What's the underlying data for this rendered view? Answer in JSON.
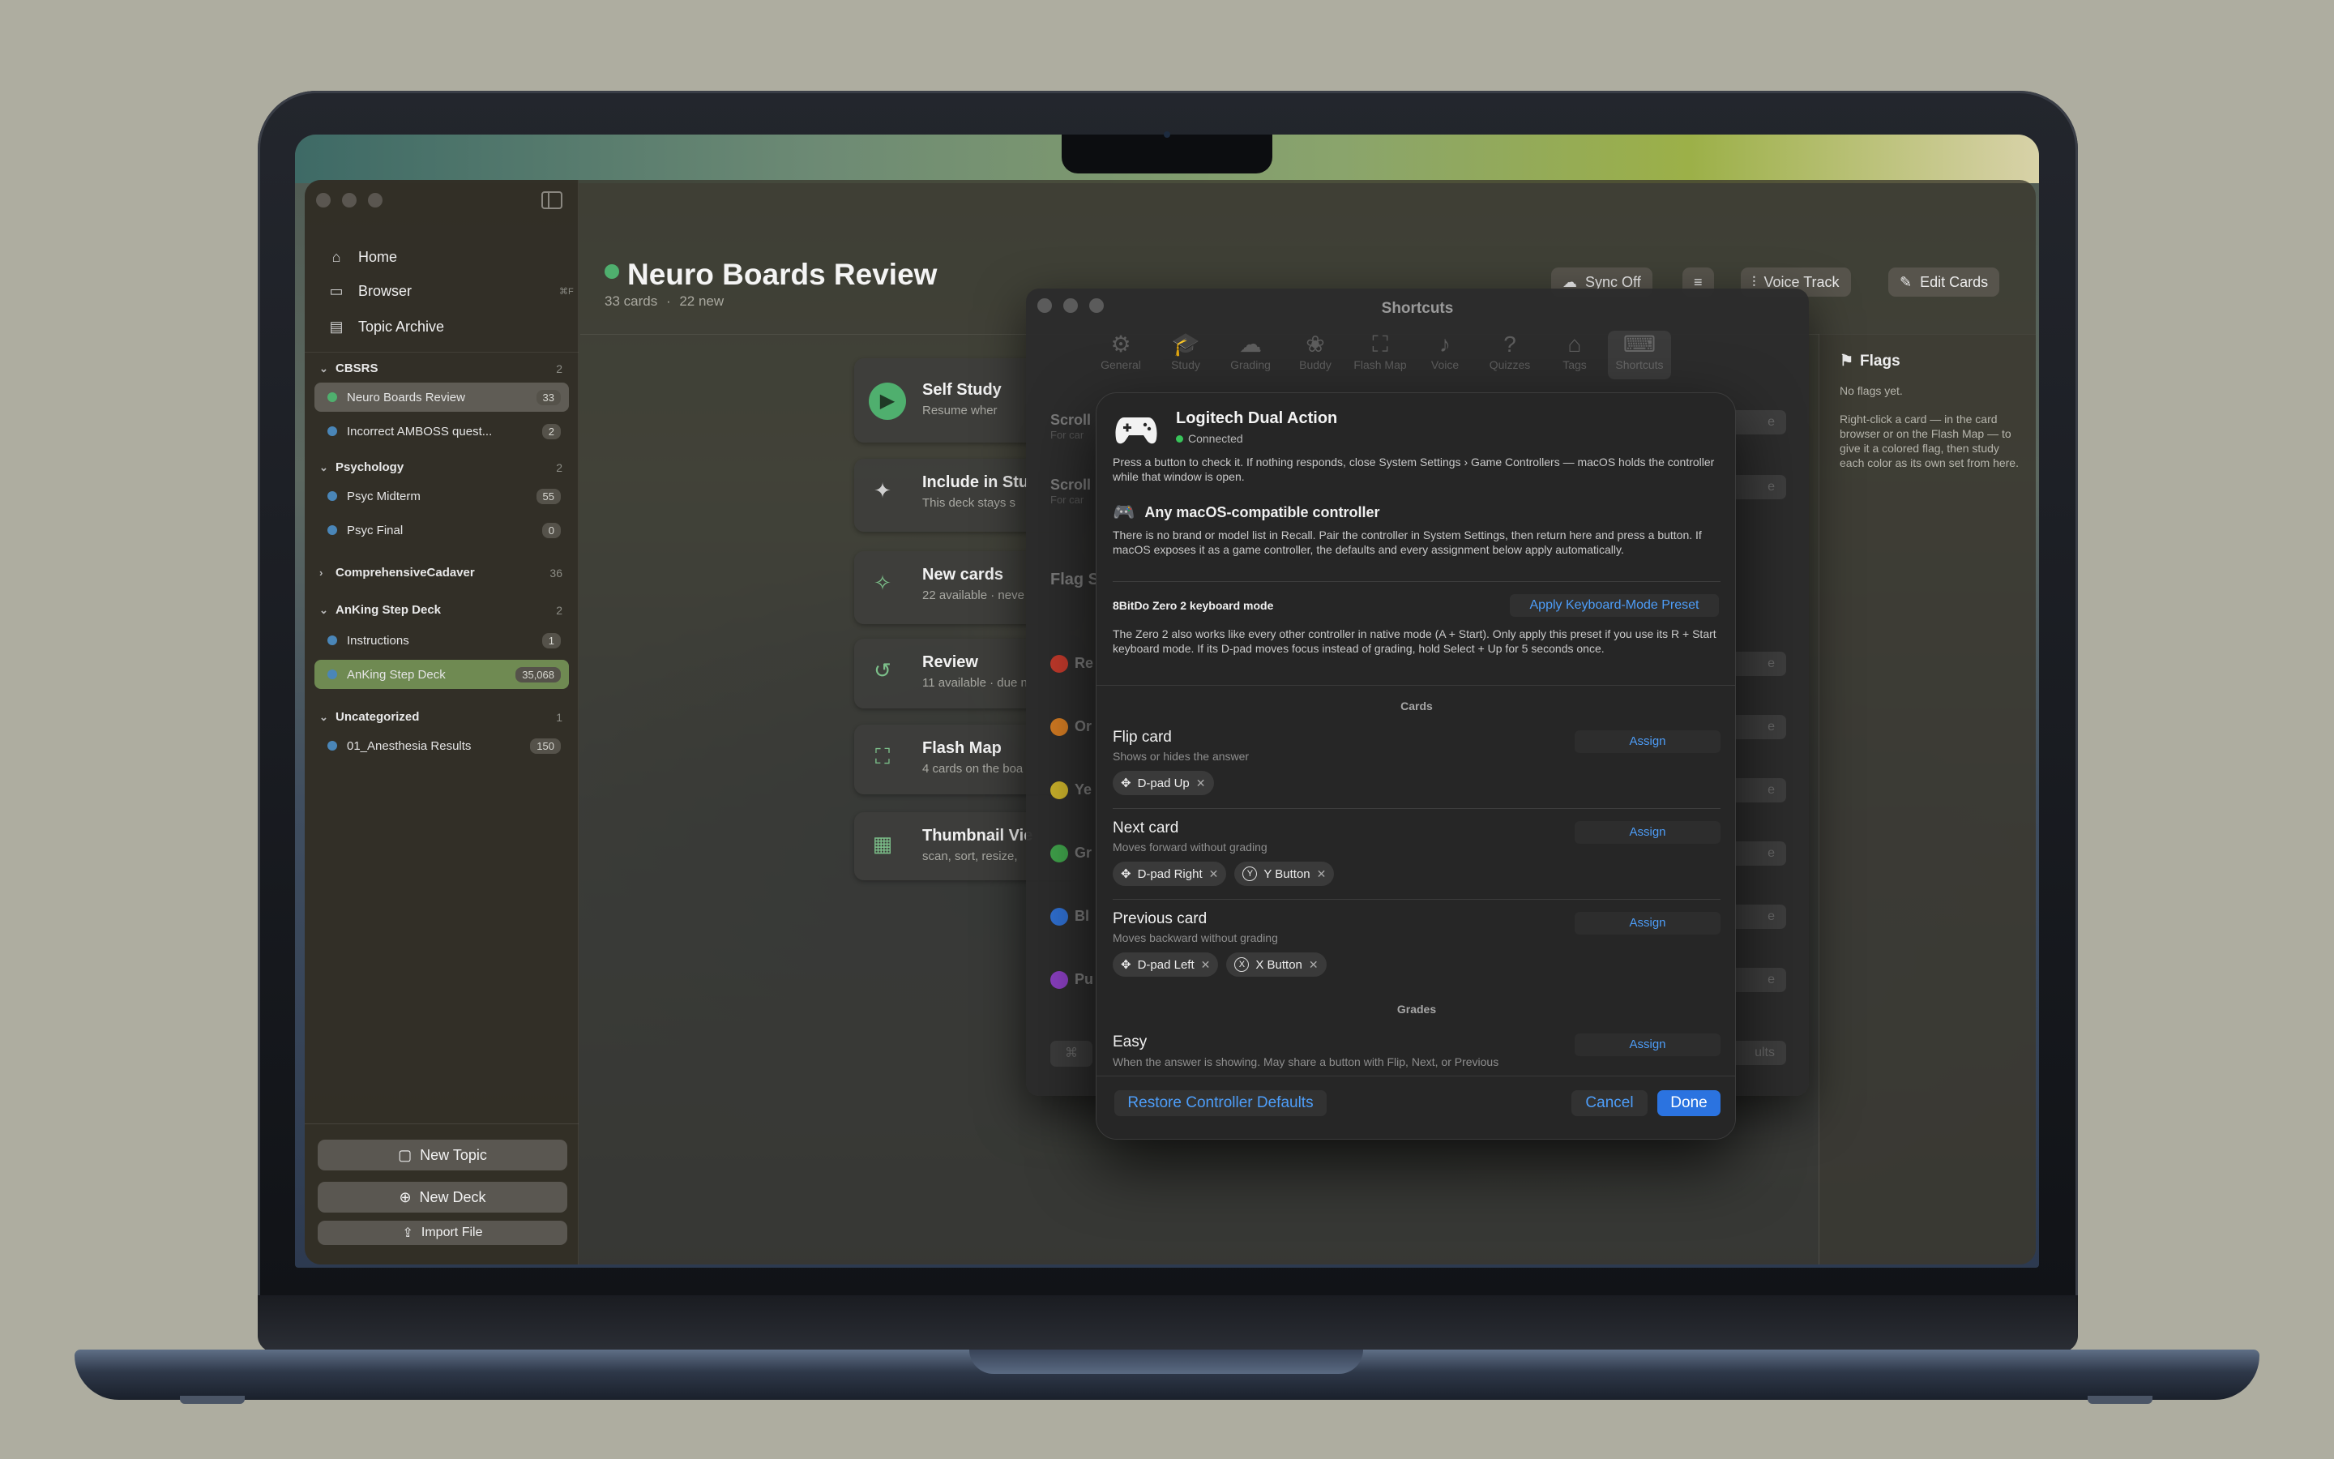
{
  "sidebar": {
    "nav": [
      {
        "label": "Home"
      },
      {
        "label": "Browser",
        "shortcut": "⌘F"
      },
      {
        "label": "Topic Archive"
      }
    ],
    "sections": [
      {
        "name": "CBSRS",
        "count": "2",
        "decks": [
          {
            "name": "Neuro Boards Review",
            "count": "33"
          },
          {
            "name": "Incorrect AMBOSS quest...",
            "count": "2"
          }
        ]
      },
      {
        "name": "Psychology",
        "count": "2",
        "decks": [
          {
            "name": "Psyc Midterm",
            "count": "55"
          },
          {
            "name": "Psyc Final",
            "count": "0"
          }
        ]
      },
      {
        "name": "ComprehensiveCadaver",
        "count": "36",
        "decks": []
      },
      {
        "name": "AnKing Step Deck",
        "count": "2",
        "decks": [
          {
            "name": "Instructions",
            "count": "1"
          },
          {
            "name": "AnKing Step Deck",
            "count": "35,068"
          }
        ]
      },
      {
        "name": "Uncategorized",
        "count": "1",
        "decks": [
          {
            "name": "01_Anesthesia Results",
            "count": "150"
          }
        ]
      }
    ],
    "buttons": {
      "new_topic": "New Topic",
      "new_deck": "New Deck",
      "import_file": "Import File"
    }
  },
  "main": {
    "title": "Neuro Boards Review",
    "cards_count": "33 cards",
    "separator": "·",
    "new_count": "22 new",
    "toolbar": {
      "sync": "Sync Off",
      "voice": "Voice Track",
      "edit": "Edit Cards"
    },
    "study_cards": [
      {
        "title": "Self Study",
        "subtitle": "Resume wher"
      },
      {
        "title": "Include in Stu",
        "subtitle": "This deck stays s"
      },
      {
        "title": "New cards",
        "subtitle": "22 available · neve"
      },
      {
        "title": "Review",
        "subtitle": "11 available · due n"
      },
      {
        "title": "Flash Map",
        "subtitle": "4 cards on the boa"
      },
      {
        "title": "Thumbnail Vie",
        "subtitle": "scan, sort, resize,"
      }
    ],
    "flags": {
      "title": "Flags",
      "empty": "No flags yet.",
      "help": "Right-click a card — in the card browser or on the Flash Map — to give it a colored flag, then study each color as its own set from here."
    }
  },
  "settings": {
    "title": "Shortcuts",
    "tabs": [
      "General",
      "Study",
      "Grading",
      "Buddy",
      "Flash Map",
      "Voice",
      "Quizzes",
      "Tags",
      "Shortcuts"
    ],
    "rows": [
      {
        "title": "Scroll",
        "sub": "For car"
      },
      {
        "title": "Scroll",
        "sub": "For car"
      }
    ],
    "flag_section": "Flag S",
    "flag_rows": [
      "Re",
      "Or",
      "Ye",
      "Gr",
      "Bl",
      "Pu"
    ],
    "restore_partial": "ults"
  },
  "controller": {
    "name": "Logitech Dual Action",
    "status": "Connected",
    "intro": "Press a button to check it. If nothing responds, close System Settings › Game Controllers — macOS holds the controller while that window is open.",
    "any_title": "Any macOS-compatible controller",
    "any_text": "There is no brand or model list in Recall. Pair the controller in System Settings, then return here and press a button. If macOS exposes it as a game controller, the defaults and every assignment below apply automatically.",
    "zero2_title": "8BitDo Zero 2 keyboard mode",
    "zero2_button": "Apply Keyboard-Mode Preset",
    "zero2_text": "The Zero 2 also works like every other controller in native mode (A + Start). Only apply this preset if you use its R + Start keyboard mode. If its D-pad moves focus instead of grading, hold Select + Up for 5 seconds once.",
    "groups": {
      "cards": "Cards",
      "grades": "Grades"
    },
    "assign_label": "Assign",
    "actions": [
      {
        "title": "Flip card",
        "sub": "Shows or hides the answer",
        "chips": [
          {
            "icon": "dpad",
            "label": "D-pad Up"
          }
        ]
      },
      {
        "title": "Next card",
        "sub": "Moves forward without grading",
        "chips": [
          {
            "icon": "dpad",
            "label": "D-pad Right"
          },
          {
            "icon": "Y",
            "label": "Y Button"
          }
        ]
      },
      {
        "title": "Previous card",
        "sub": "Moves backward without grading",
        "chips": [
          {
            "icon": "dpad",
            "label": "D-pad Left"
          },
          {
            "icon": "X",
            "label": "X Button"
          }
        ]
      },
      {
        "title": "Easy",
        "sub": "When the answer is showing. May share a button with Flip, Next, or Previous"
      }
    ],
    "footer": {
      "restore": "Restore Controller Defaults",
      "cancel": "Cancel",
      "done": "Done"
    }
  }
}
